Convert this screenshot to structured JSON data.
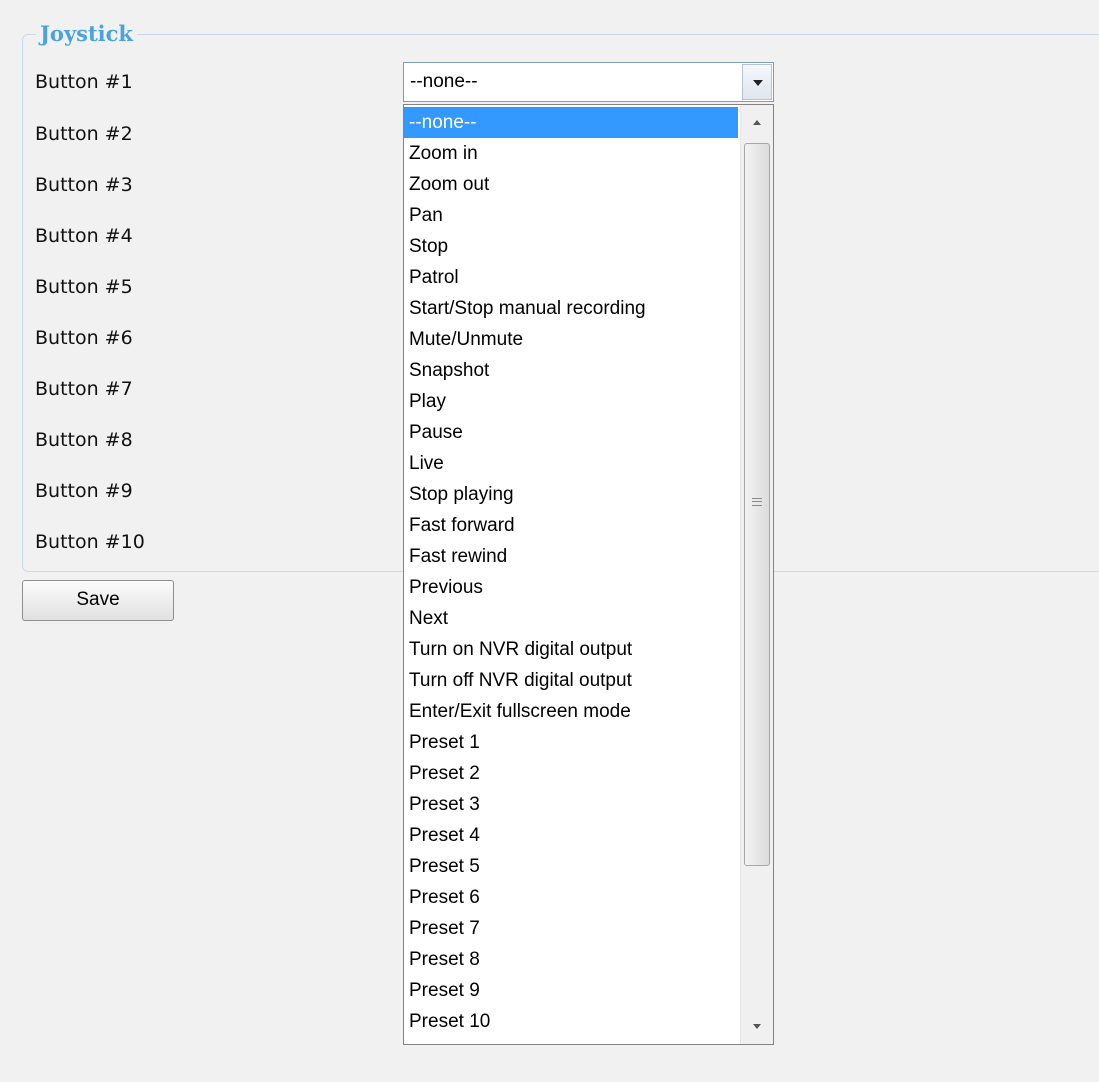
{
  "fieldset": {
    "legend": "Joystick"
  },
  "rows": [
    {
      "label": "Button #1"
    },
    {
      "label": "Button #2"
    },
    {
      "label": "Button #3"
    },
    {
      "label": "Button #4"
    },
    {
      "label": "Button #5"
    },
    {
      "label": "Button #6"
    },
    {
      "label": "Button #7"
    },
    {
      "label": "Button #8"
    },
    {
      "label": "Button #9"
    },
    {
      "label": "Button #10"
    }
  ],
  "select": {
    "value": "--none--",
    "options": [
      "--none--",
      "Zoom in",
      "Zoom out",
      "Pan",
      "Stop",
      "Patrol",
      "Start/Stop manual recording",
      "Mute/Unmute",
      "Snapshot",
      "Play",
      "Pause",
      "Live",
      "Stop playing",
      "Fast forward",
      "Fast rewind",
      "Previous",
      "Next",
      "Turn on NVR digital output",
      "Turn off NVR digital output",
      "Enter/Exit fullscreen mode",
      "Preset 1",
      "Preset 2",
      "Preset 3",
      "Preset 4",
      "Preset 5",
      "Preset 6",
      "Preset 7",
      "Preset 8",
      "Preset 9",
      "Preset 10"
    ],
    "highlighted_index": 0
  },
  "actions": {
    "save_label": "Save"
  },
  "colors": {
    "legend": "#4aa3df",
    "highlight": "#3399ff",
    "page_background": "#f1f1f1"
  }
}
